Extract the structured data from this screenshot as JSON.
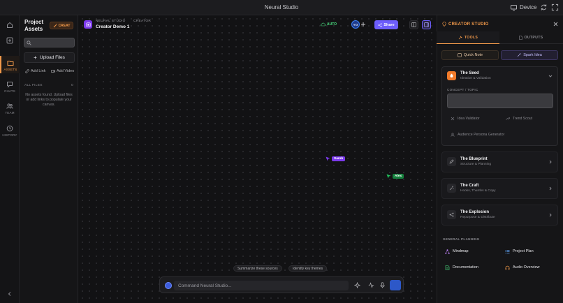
{
  "window": {
    "title": "Neural Studio",
    "device_label": "Device"
  },
  "rail": {
    "items": [
      {
        "label": ""
      },
      {
        "label": ""
      },
      {
        "label": "ASSETS"
      },
      {
        "label": "CHATS"
      },
      {
        "label": "TEAM"
      },
      {
        "label": "HISTORY"
      }
    ]
  },
  "assets": {
    "title": "Project Assets",
    "create_label": "CREAT",
    "search_placeholder": "",
    "upload_label": "Upload Files",
    "add_link_label": "Add Link",
    "add_video_label": "Add Video",
    "all_files_label": "ALL FILES",
    "file_count": "0",
    "empty_message": "No assets found. Upload files or add links to populate your canvas."
  },
  "header": {
    "brand": "NEURAL STUDIO",
    "mode": "CREATOR",
    "project_name": "Creator Demo 1",
    "sync_status": "AUTO",
    "avatar_initials": "YO",
    "share_label": "Share"
  },
  "canvas": {
    "cursors": [
      {
        "name": "Sarah",
        "color": "#7c3aed"
      },
      {
        "name": "Alex",
        "color": "#16a34a"
      }
    ],
    "suggestions": [
      "Summarize these sources",
      "Identify key themes"
    ],
    "command_placeholder": "Command Neural Studio..."
  },
  "panel": {
    "title": "CREATOR STUDIO",
    "tabs": [
      {
        "label": "TOOLS",
        "active": true
      },
      {
        "label": "OUTPUTS",
        "active": false
      }
    ],
    "quick_note_label": "Quick Note",
    "spark_idea_label": "Spark Idea",
    "seed": {
      "title": "The Seed",
      "subtitle": "Ideation & Validation",
      "concept_label": "CONCEPT / TOPIC",
      "tools": [
        "Idea Validator",
        "Trend Scout",
        "Audience Persona Generator"
      ]
    },
    "stages": [
      {
        "title": "The Blueprint",
        "subtitle": "Structure & Planning"
      },
      {
        "title": "The Craft",
        "subtitle": "Hooks, Thumbs & Copy"
      },
      {
        "title": "The Explosion",
        "subtitle": "Repurpose & Distribute"
      }
    ],
    "general_planning_label": "GENERAL PLANNING",
    "general_items": [
      {
        "label": "Mindmap",
        "color": "#c084fc"
      },
      {
        "label": "Project Plan",
        "color": "#60a5fa"
      },
      {
        "label": "Documentation",
        "color": "#4ade80"
      },
      {
        "label": "Audio Overview",
        "color": "#f39a4a"
      }
    ]
  },
  "colors": {
    "accent": "#f39a4a",
    "primary": "#6d5dfc",
    "success": "#4ade80"
  }
}
